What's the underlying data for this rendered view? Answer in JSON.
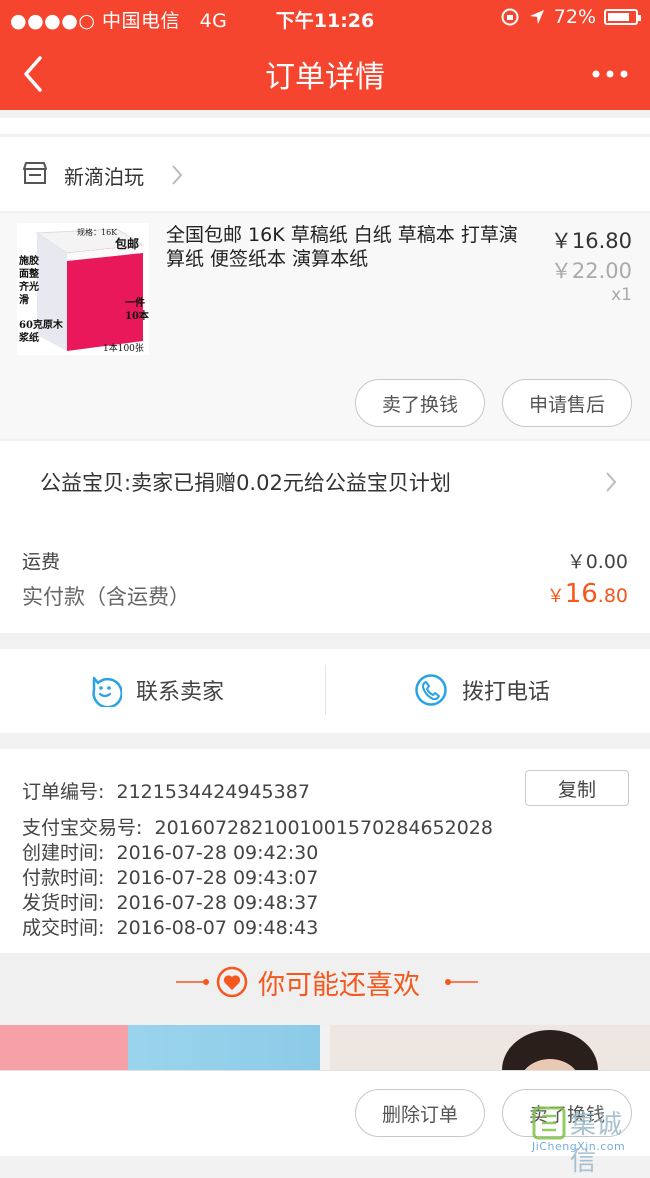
{
  "status_bar": {
    "signal": "●●●●○",
    "carrier": "中国电信",
    "network": "4G",
    "time": "下午11:26",
    "battery": "72%"
  },
  "nav": {
    "title": "订单详情"
  },
  "store": {
    "name": "新滴泊玩"
  },
  "product": {
    "title": "全国包邮 16K 草稿纸 白纸 草稿本 打草演算纸 便签纸本 演算本纸",
    "price": "￥16.80",
    "original_price": "￥22.00",
    "quantity": "x1",
    "image_texts": {
      "spec": "规格：16K",
      "free_ship": "包邮",
      "features": "施胶面整齐光滑",
      "weight": "60克原木浆纸",
      "pack": "一件10本",
      "count": "1本100张"
    }
  },
  "item_actions": {
    "sell": "卖了换钱",
    "after_sale": "申请售后"
  },
  "charity": {
    "text": "公益宝贝:卖家已捐赠0.02元给公益宝贝计划"
  },
  "fees": {
    "shipping_label": "运费",
    "shipping_value": "￥0.00",
    "paid_label": "实付款（含运费）",
    "paid_currency": "￥",
    "paid_int": "16",
    "paid_dec": ".80"
  },
  "contact": {
    "seller": "联系卖家",
    "call": "拨打电话"
  },
  "order_info": {
    "order_no_label": "订单编号:",
    "order_no": "2121534424945387",
    "copy": "复制",
    "alipay_label": "支付宝交易号:",
    "alipay_no": "2016072821001001570284652028",
    "created_label": "创建时间:",
    "created": "2016-07-28 09:42:30",
    "paid_label": "付款时间:",
    "paid": "2016-07-28 09:43:07",
    "shipped_label": "发货时间:",
    "shipped": "2016-07-28 09:48:37",
    "done_label": "成交时间:",
    "done": "2016-08-07 09:48:43"
  },
  "recommend": {
    "title": "你可能还喜欢"
  },
  "bottom_bar": {
    "delete": "删除订单",
    "sell": "卖了换钱"
  },
  "watermark": {
    "text": "集诚信",
    "url": "JiChengXin.com"
  },
  "colors": {
    "header": "#f5452f",
    "accent": "#f5571c",
    "icon_blue": "#29a3e6"
  }
}
